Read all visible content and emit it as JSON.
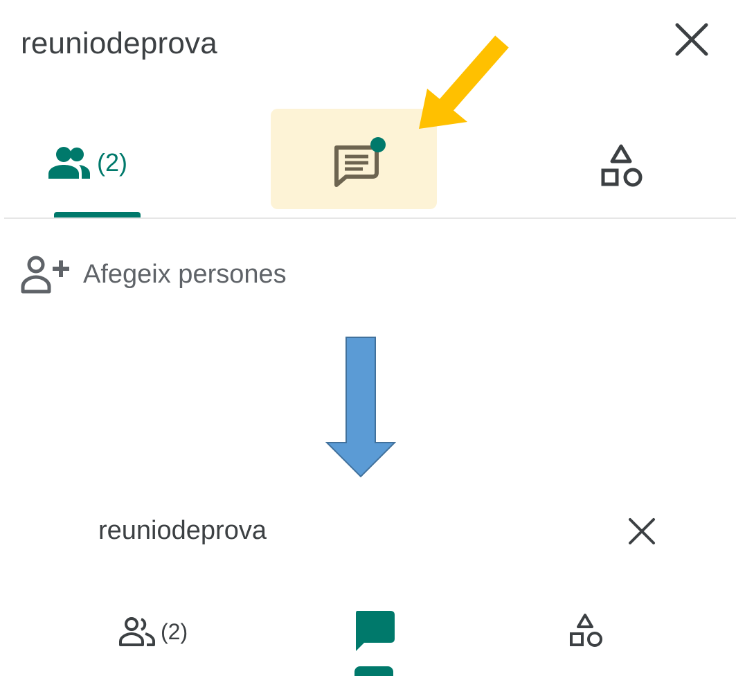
{
  "top_panel": {
    "title": "reuniodeprova",
    "tabs": [
      {
        "name": "people",
        "count": "(2)",
        "icon": "people-icon",
        "active": true
      },
      {
        "name": "chat",
        "icon": "chat-icon",
        "notification_dot": true,
        "highlighted": true
      },
      {
        "name": "activities",
        "icon": "activities-icon"
      }
    ],
    "add_people_label": "Afegeix persones"
  },
  "bottom_panel": {
    "title": "reuniodeprova",
    "tabs": [
      {
        "name": "people",
        "count": "(2)",
        "icon": "people-outline-icon"
      },
      {
        "name": "chat",
        "icon": "chat-filled-icon",
        "active": true
      },
      {
        "name": "activities",
        "icon": "activities-icon"
      }
    ]
  },
  "annotations": {
    "pointer_arrow_color": "#FFC000",
    "transition_arrow_color": "#5B9BD5"
  },
  "colors": {
    "accent": "#00796B",
    "text": "#3C4043",
    "highlight": "#FDF3D6",
    "icon_gray": "#5F6368"
  }
}
